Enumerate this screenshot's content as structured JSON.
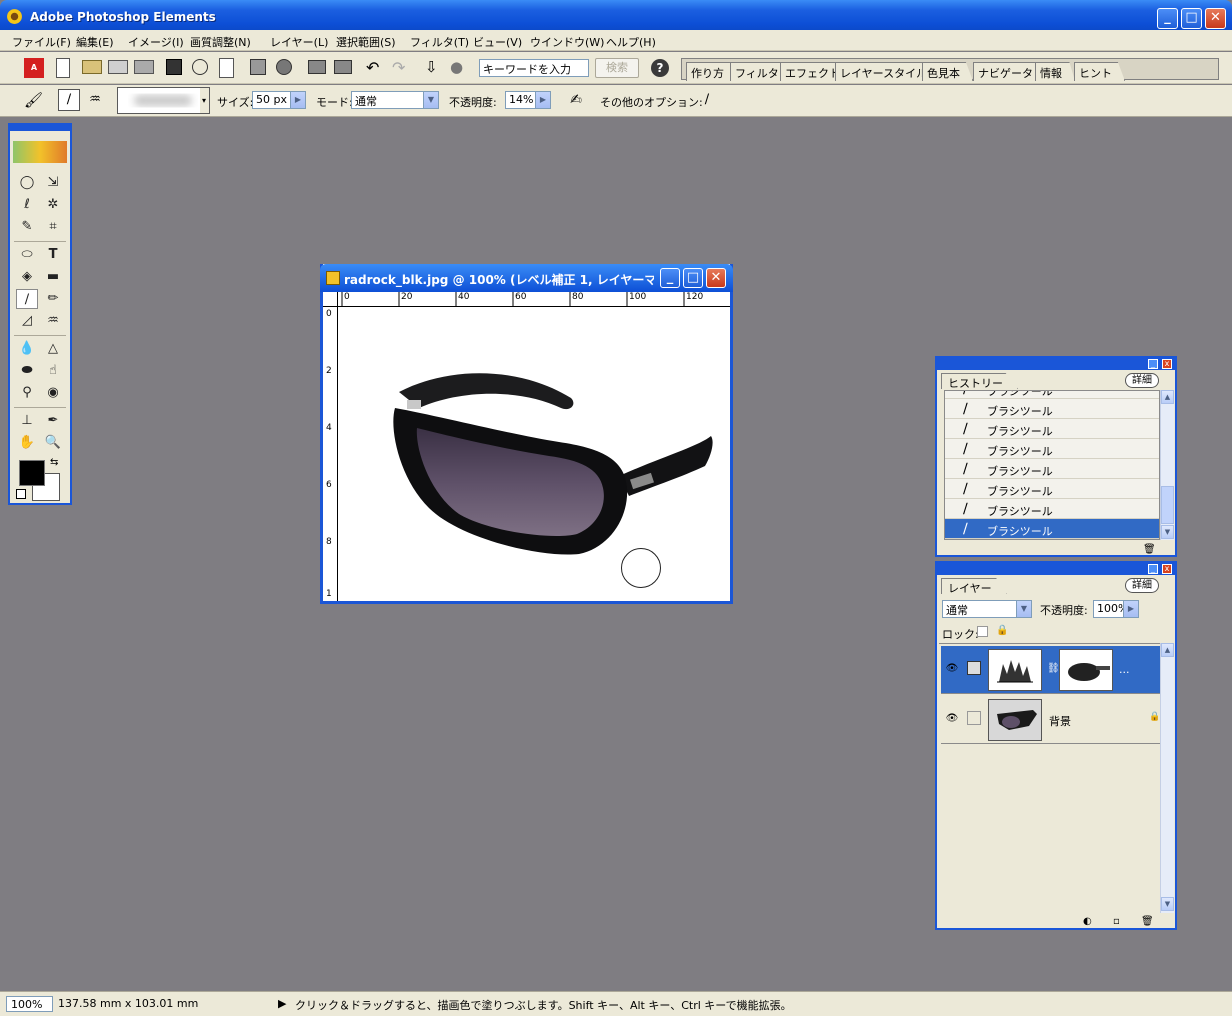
{
  "app": {
    "title": "Adobe Photoshop Elements"
  },
  "menu": [
    "ファイル(F)",
    "編集(E)",
    "イメージ(I)",
    "画質調整(N)",
    "レイヤー(L)",
    "選択範囲(S)",
    "フィルタ(T)",
    "ビュー(V)",
    "ウインドウ(W)",
    "ヘルプ(H)"
  ],
  "shortcuts": {
    "keyword_placeholder": "キーワードを入力",
    "search_label": "検索",
    "help_label": "?"
  },
  "palette_well": {
    "tabs": [
      "作り方",
      "フィルタ",
      "エフェクト",
      "レイヤースタイル",
      "色見本",
      "ナビゲータ",
      "情報",
      "ヒント"
    ]
  },
  "options_bar": {
    "size_label": "サイズ:",
    "size_value": "50 px",
    "mode_label": "モード:",
    "mode_value": "通常",
    "opacity_label": "不透明度:",
    "opacity_value": "14%",
    "more_options_label": "その他のオプション:"
  },
  "document": {
    "title": "radrock_blk.jpg @ 100% (レベル補正 1, レイヤーマ...",
    "ruler_top": [
      "0",
      "20",
      "40",
      "60",
      "80",
      "100",
      "120"
    ],
    "ruler_left": [
      "0",
      "2",
      "4",
      "6",
      "8",
      "1"
    ]
  },
  "history_panel": {
    "tab": "ヒストリー",
    "more": "詳細",
    "items": [
      "ブラシツール",
      "ブラシツール",
      "ブラシツール",
      "ブラシツール",
      "ブラシツール",
      "ブラシツール",
      "ブラシツール",
      "ブラシツール"
    ]
  },
  "layers_panel": {
    "tab": "レイヤー",
    "more": "詳細",
    "blend_mode": "通常",
    "opacity_label": "不透明度:",
    "opacity_value": "100%",
    "lock_label": "ロック:",
    "layers": [
      {
        "name": "...",
        "type": "adjustment"
      },
      {
        "name": "背景",
        "type": "background"
      }
    ]
  },
  "status_bar": {
    "zoom": "100%",
    "doc_size": "137.58 mm x 103.01 mm",
    "hint": "クリック＆ドラッグすると、描画色で塗りつぶします。Shift キー、Alt キー、Ctrl キーで機能拡張。"
  },
  "colors": {
    "accent": "#1a56d8",
    "selection": "#316ac5",
    "workspace": "#7f7d82"
  }
}
